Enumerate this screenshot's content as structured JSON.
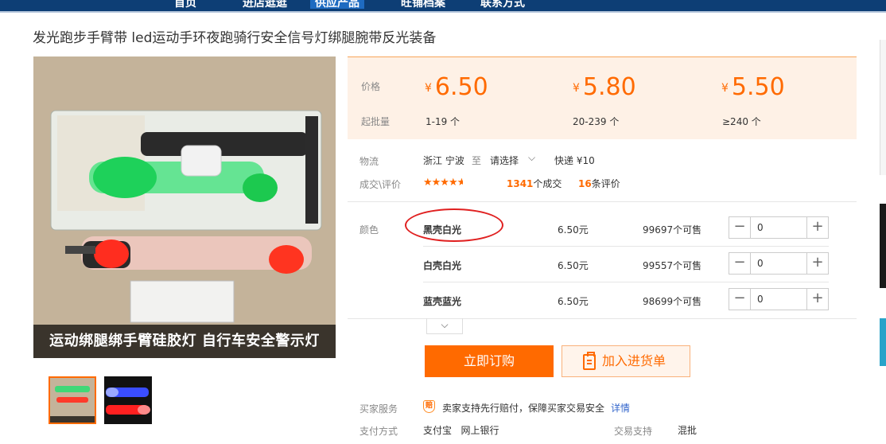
{
  "nav": {
    "items": [
      "首页",
      "进店逛逛",
      "供应产品",
      "旺铺档案",
      "联系方式"
    ],
    "active_index": 2
  },
  "product": {
    "title": "发光跑步手臂带 led运动手环夜跑骑行安全信号灯绑腿腕带反光装备",
    "image_caption": "运动绑腿绑手臂硅胶灯  自行车安全警示灯"
  },
  "price_panel": {
    "price_label": "价格",
    "moq_label": "起批量",
    "currency": "¥",
    "tiers": [
      {
        "price": "6.50",
        "range": "1-19 个"
      },
      {
        "price": "5.80",
        "range": "20-239 个"
      },
      {
        "price": "5.50",
        "range": "≥240 个"
      }
    ]
  },
  "logistics": {
    "label": "物流",
    "origin": "浙江 宁波",
    "to": "至",
    "dest_select": "请选择",
    "express": "快递 ¥10"
  },
  "trade": {
    "label": "成交\\评价",
    "rating": 4.5,
    "deals_count": "1341",
    "deals_suffix": "个成交",
    "reviews_count": "16",
    "reviews_suffix": "条评价"
  },
  "variants": {
    "label": "颜色",
    "items": [
      {
        "name": "黑壳白光",
        "price": "6.50元",
        "stock": "99697个可售",
        "qty": "0"
      },
      {
        "name": "白壳白光",
        "price": "6.50元",
        "stock": "99557个可售",
        "qty": "0"
      },
      {
        "name": "蓝壳蓝光",
        "price": "6.50元",
        "stock": "98699个可售",
        "qty": "0"
      }
    ],
    "expand_icon": "chevron-down"
  },
  "actions": {
    "buy_label": "立即订购",
    "cart_label": "加入进货单"
  },
  "service": {
    "label": "买家服务",
    "badge": "赔",
    "text": "卖家支持先行赔付，保障买家交易安全",
    "link": "详情"
  },
  "payment": {
    "label": "支付方式",
    "methods": "支付宝   网上银行",
    "trade_support_label": "交易支持",
    "trade_support_value": "混批"
  },
  "colors": {
    "accent": "#ff6a00",
    "nav_bg": "#0d3e75",
    "annotation": "#e02020"
  }
}
